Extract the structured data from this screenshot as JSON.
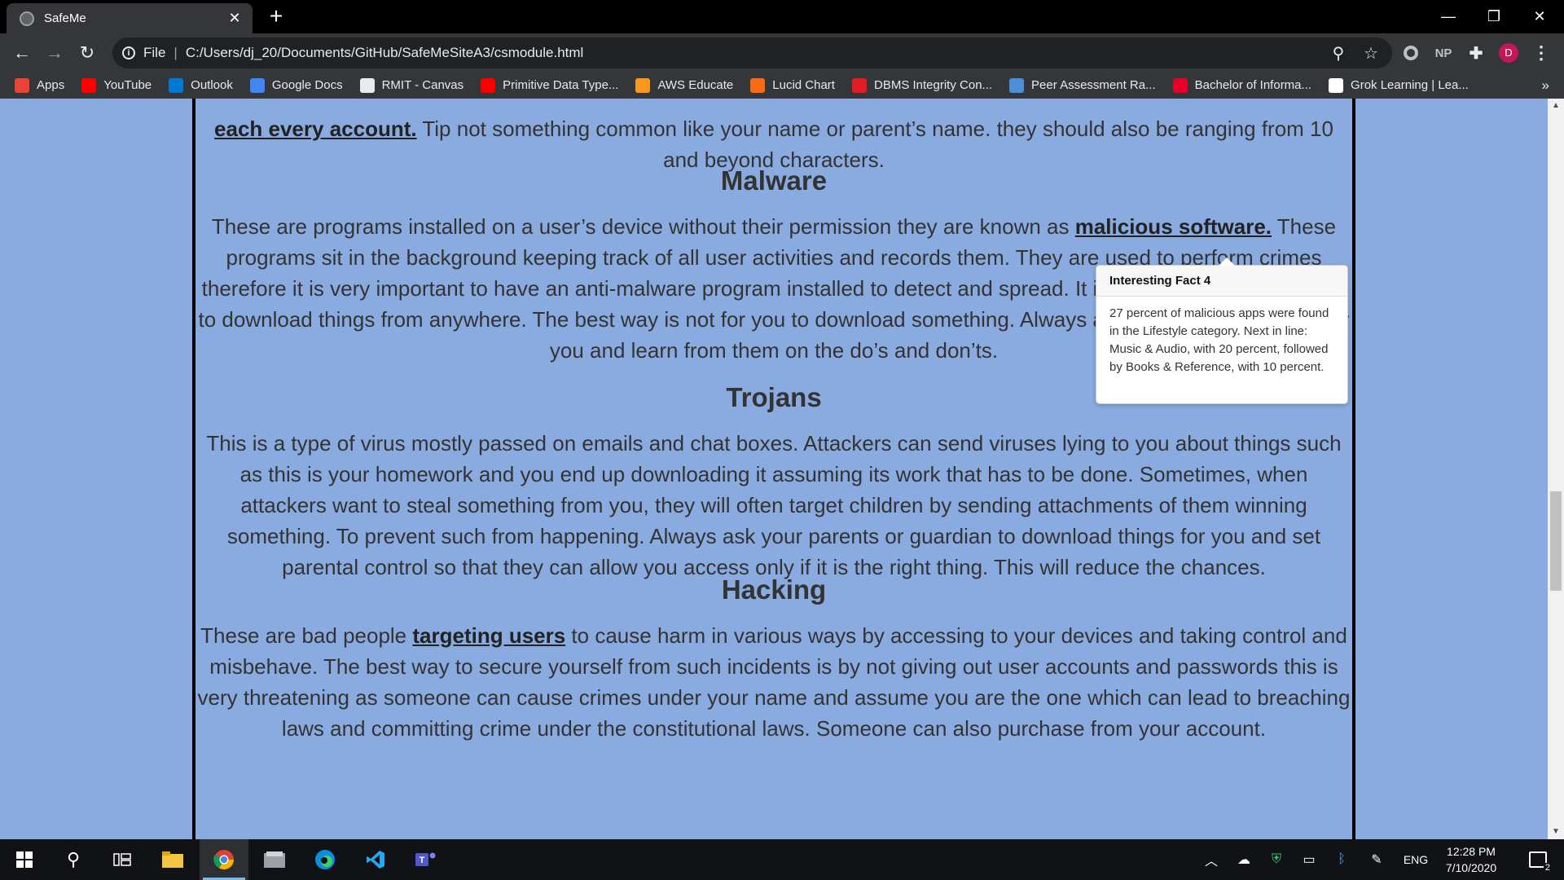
{
  "browser": {
    "tab_title": "SafeMe",
    "address_prefix": "File",
    "address_url": "C:/Users/dj_20/Documents/GitHub/SafeMeSiteA3/csmodule.html",
    "profile_initial": "D",
    "ext_np": "NP"
  },
  "bookmarks": [
    {
      "label": "Apps",
      "icon": "apps-grid-icon",
      "color": "#ea4335"
    },
    {
      "label": "YouTube",
      "icon": "youtube-icon",
      "color": "#ff0000"
    },
    {
      "label": "Outlook",
      "icon": "outlook-icon",
      "color": "#0078d4"
    },
    {
      "label": "Google Docs",
      "icon": "google-docs-icon",
      "color": "#4285f4"
    },
    {
      "label": "RMIT - Canvas",
      "icon": "canvas-icon",
      "color": "#e8eaed"
    },
    {
      "label": "Primitive Data Type...",
      "icon": "oracle-icon",
      "color": "#f80000"
    },
    {
      "label": "AWS Educate",
      "icon": "aws-icon",
      "color": "#f7981d"
    },
    {
      "label": "Lucid Chart",
      "icon": "lucidchart-icon",
      "color": "#f96b13"
    },
    {
      "label": "DBMS Integrity Con...",
      "icon": "dbms-icon",
      "color": "#e31b23"
    },
    {
      "label": "Peer Assessment Ra...",
      "icon": "peer-assessment-icon",
      "color": "#4a90d9"
    },
    {
      "label": "Bachelor of Informa...",
      "icon": "rmit-icon",
      "color": "#e60028"
    },
    {
      "label": "Grok Learning | Lea...",
      "icon": "grok-icon",
      "color": "#ffffff"
    }
  ],
  "bookmarks_more": "»",
  "page": {
    "top_para": {
      "link": "each every account.",
      "rest": " Tip not something common like your name or parent’s name. they should also be ranging from 10 and beyond characters."
    },
    "malware": {
      "heading": "Malware",
      "line1_text": "These are programs installed on a user’s device without their permission they are known as ",
      "line1_link": "malicious software.",
      "rest": "These programs sit in the background keeping track of all user activities and records them. They are used to perform crimes therefore it is very important to have an anti-malware program installed to detect and spread. It is highly recommended not to download things from anywhere. The best way is not for you to download something. Always ask your parents to do it for you and learn from them on the do’s and don’ts."
    },
    "trojans": {
      "heading": "Trojans",
      "text": "This is a type of virus mostly passed on emails and chat boxes. Attackers can send viruses lying to you about things such as this is your homework and you end up downloading it assuming its work that has to be done. Sometimes, when attackers want to steal something from you, they will often target children by sending attachments of them winning something. To prevent such from happening. Always ask your parents or guardian to download things for you and set parental control so that they can allow you access only if it is the right thing. This will reduce the chances."
    },
    "hacking": {
      "heading": "Hacking",
      "text_before": "These are bad people ",
      "link": "targeting users",
      "text_after": " to cause harm in various ways by accessing to your devices and taking control and misbehave. The best way to secure yourself from such incidents is by not giving out user accounts and passwords this is very threatening as someone can cause crimes under your name and assume you are the one which can lead to breaching laws and committing crime under the constitutional laws. Someone can also purchase from your account."
    },
    "tooltip": {
      "title": "Interesting Fact 4",
      "body": "27 percent of malicious apps were found in the Lifestyle category. Next in line: Music & Audio, with 20 percent, followed by Books & Reference, with 10 percent."
    }
  },
  "taskbar": {
    "language": "ENG",
    "time": "12:28 PM",
    "date": "7/10/2020",
    "notification_count": "2"
  },
  "colors": {
    "page_background": "#8aabe0",
    "text": "#333333"
  }
}
